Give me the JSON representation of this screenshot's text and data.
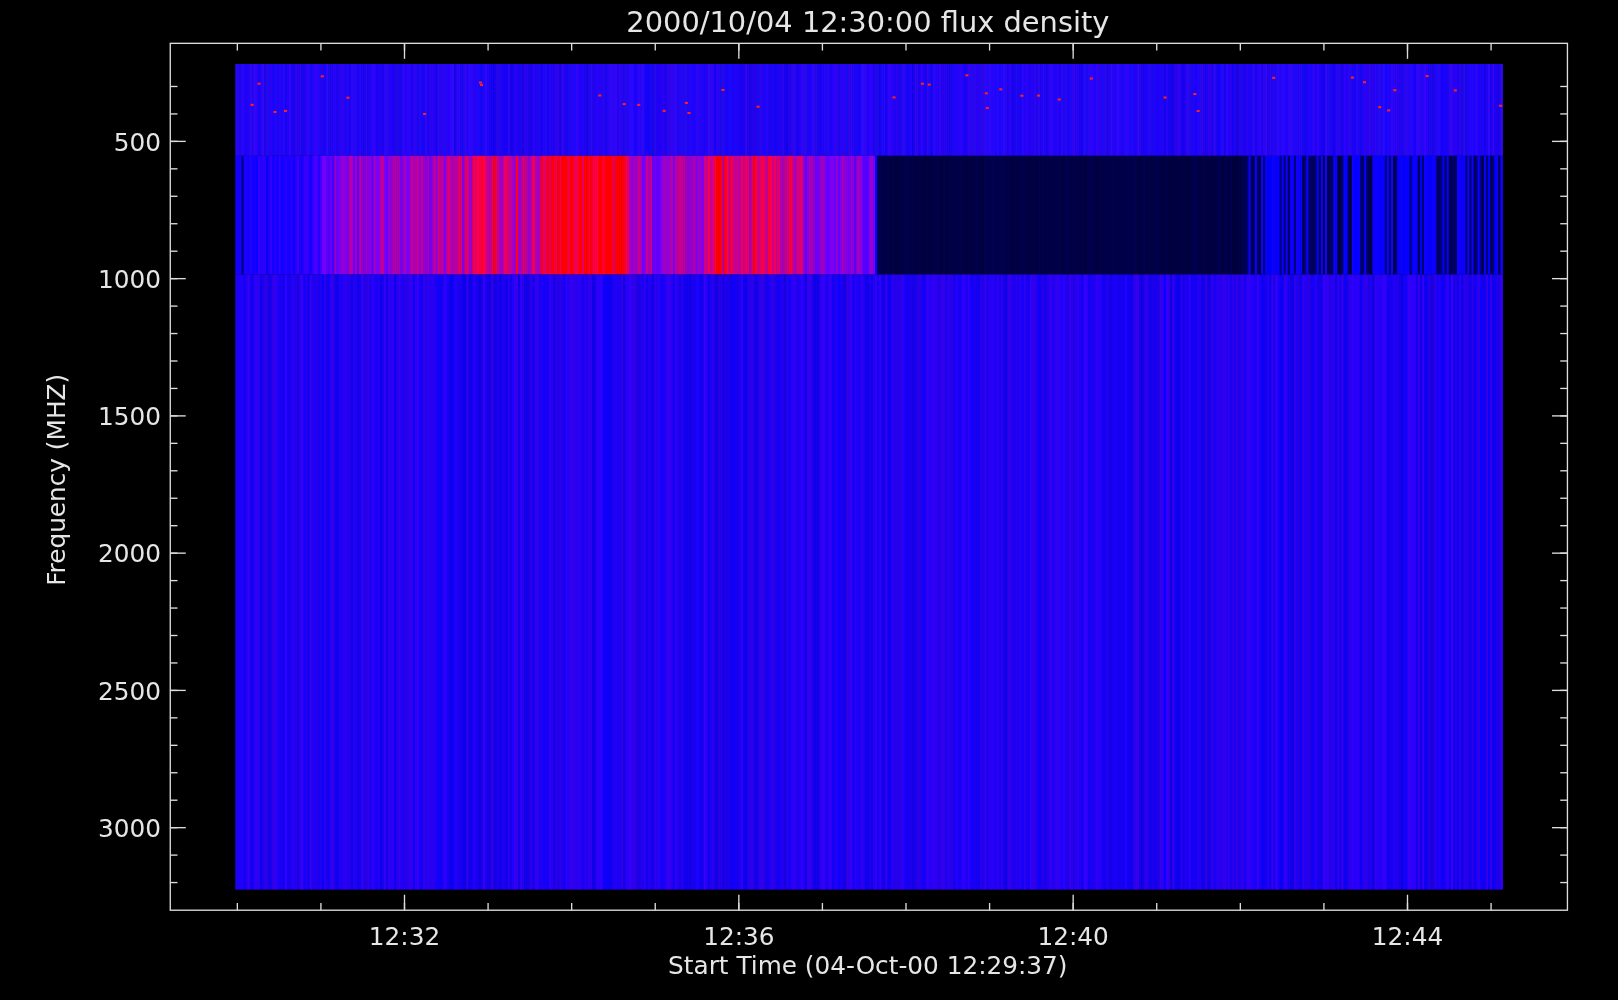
{
  "plot": {
    "title": "2000/10/04 12:30:00 flux density",
    "y_axis": {
      "label": "Frequency (MHZ)",
      "ticks": [
        "500",
        "1000",
        "1500",
        "2000",
        "2500",
        "3000"
      ]
    },
    "x_axis": {
      "label": "Start Time (04-Oct-00 12:29:37)",
      "ticks": [
        "12:32",
        "12:36",
        "12:40",
        "12:44"
      ]
    }
  }
}
